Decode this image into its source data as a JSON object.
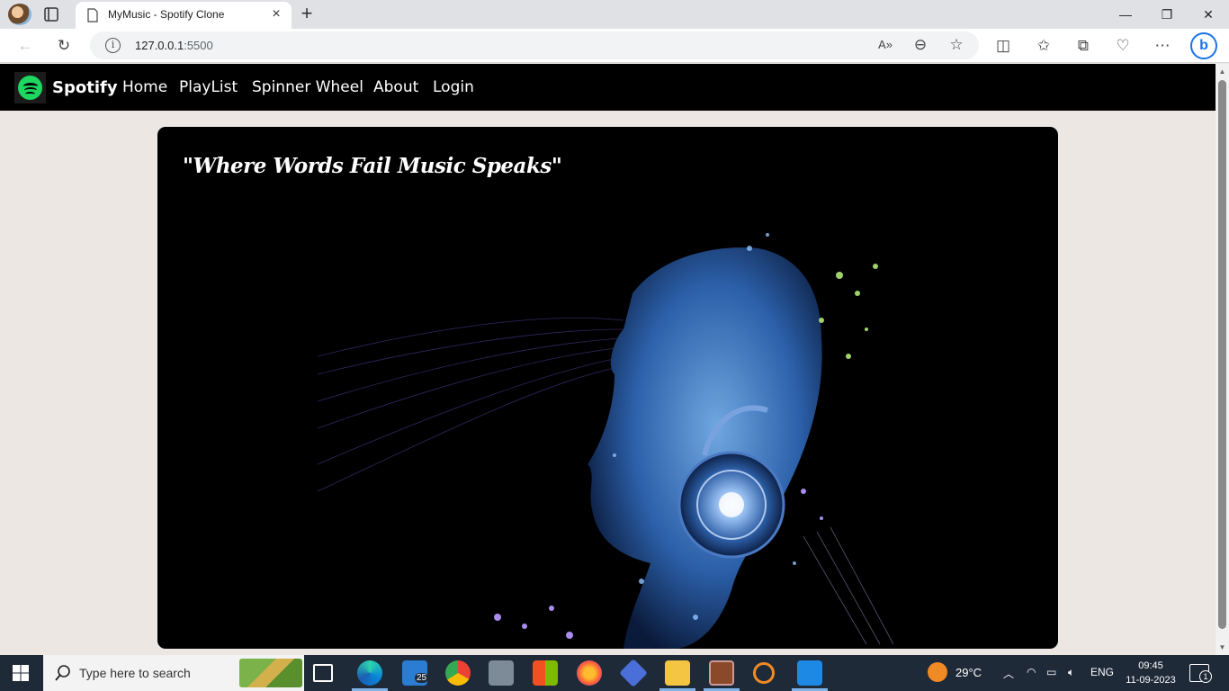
{
  "browser": {
    "tab_title": "MyMusic - Spotify Clone",
    "url_host": "127.0.0.1",
    "url_port": ":5500",
    "bing_label": "b"
  },
  "navbar": {
    "brand": "Spotify",
    "links": [
      "Home",
      "PlayList",
      "Spinner Wheel",
      "About",
      "Login"
    ],
    "accent_color": "#1ed760"
  },
  "hero": {
    "quote": "\"Where Words Fail Music Speaks\""
  },
  "taskbar": {
    "search_placeholder": "Type here to search",
    "mail_badge": "25",
    "weather": "29°C",
    "language": "ENG",
    "time": "09:45",
    "date": "11-09-2023",
    "notification_count": "1"
  }
}
